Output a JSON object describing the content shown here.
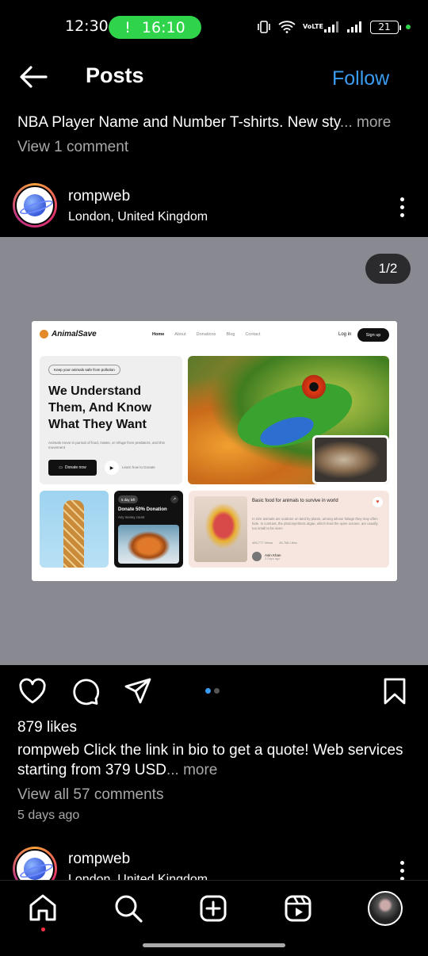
{
  "status_bar": {
    "time": "12:30",
    "call_timer": "16:10",
    "call_icon": "!",
    "network_label": "VoLTE",
    "battery": "21"
  },
  "header": {
    "back_icon": "arrow-left-icon",
    "title": "Posts",
    "follow": "Follow"
  },
  "prev_post": {
    "caption": "NBA Player Name and Number T-shirts. New sty",
    "more": "... more",
    "comments": "View 1 comment"
  },
  "post": {
    "username": "rompweb",
    "location": "London, United Kingdom",
    "image_counter": "1/2",
    "likes": "879 likes",
    "caption_user": "rompweb",
    "caption_line1": " Click the link in bio to get a quote! Web services",
    "caption_line2": "starting from 379 USD",
    "more": "... more",
    "comments": "View all 57 comments",
    "posted": "5 days ago"
  },
  "site": {
    "brand": "AnimalSave",
    "nav": [
      "Home",
      "About",
      "Donations",
      "Blog",
      "Contact"
    ],
    "login": "Log in",
    "signup": "Sign up",
    "tag": "Keep your animals safe from pollution",
    "headline": "We Understand Them, And Know What They Want",
    "hero_text": "Animals move in pursuit of food, mates, or refuge from predators, and this movement",
    "donate_button": "Donate now",
    "learn": "Learn how to Donate",
    "days_left": "5 day left",
    "donate_title": "Donate 50% Donation",
    "donate_sub": "Any money count",
    "article_title": "Basic food for animals to survive in world",
    "article_text": "In size animals are outdone on land by plants, among whose foliage they may often hide. In contrast, the photosynthetic algae, which feed the open oceans, are usually too small to be seen",
    "views": "456,777 Views",
    "likes": "46,766 Likes",
    "author": "Asin Khan",
    "author_date": "3 Days ago"
  },
  "next_post": {
    "username": "rompweb",
    "location": "London, United Kingdom"
  },
  "carousel": {
    "current": 1,
    "total": 2
  },
  "colors": {
    "accent": "#3b9bf0",
    "call_green": "#2fd44a",
    "media_bg": "#898991"
  }
}
